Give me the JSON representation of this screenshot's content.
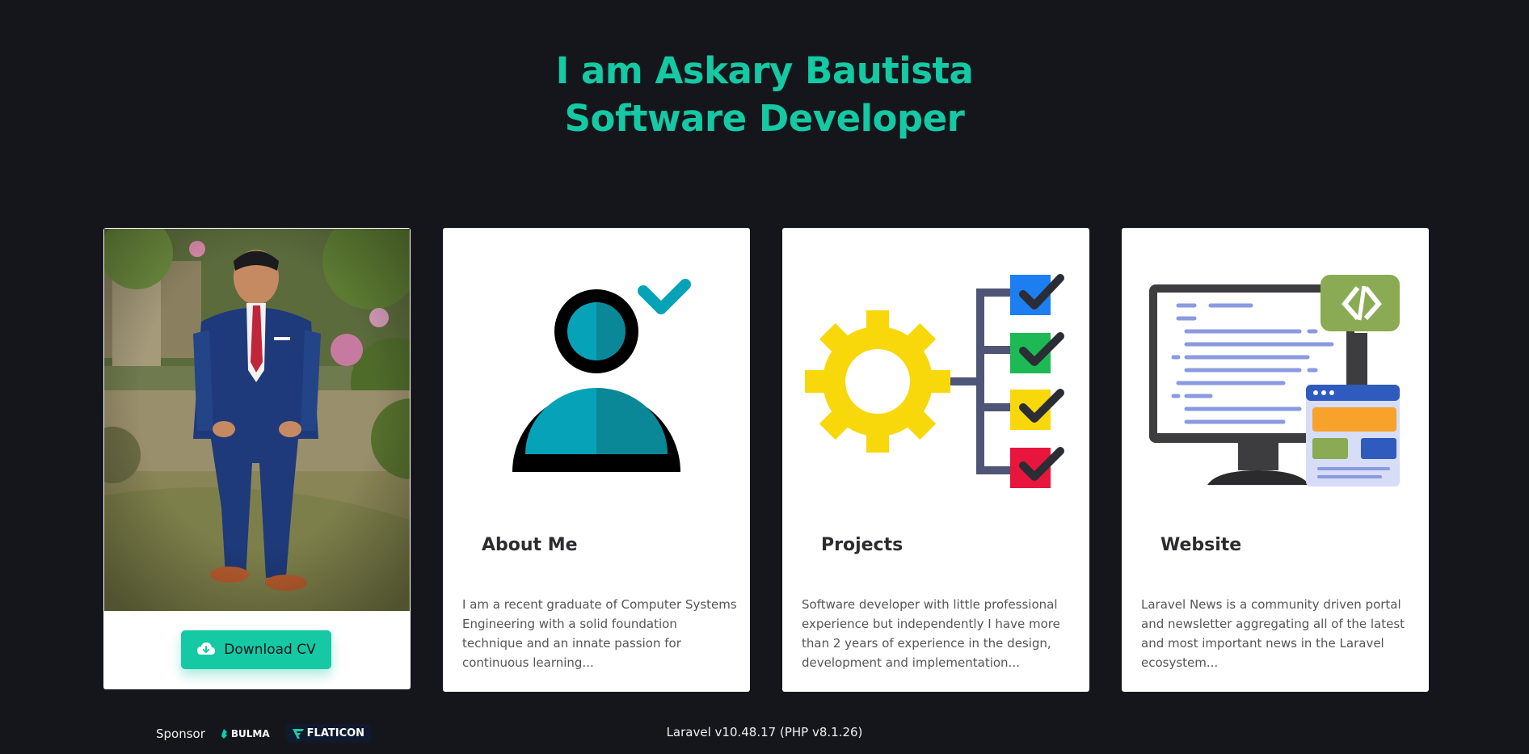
{
  "hero": {
    "line1": "I am Askary Bautista",
    "line2": "Software Developer",
    "color": "#14c9a4"
  },
  "profile": {
    "photo_alt": "Portrait photo",
    "download_label": "Download CV",
    "download_icon": "cloud-download-icon"
  },
  "cards": [
    {
      "title": "About Me",
      "icon": "user-check-illustration",
      "text": "I am a recent graduate of Computer Systems Engineering with a solid foundation technique and an innate passion for continuous learning..."
    },
    {
      "title": "Projects",
      "icon": "gear-checklist-illustration",
      "text": "Software developer with little professional experience but independently I have more than 2 years of experience in the design, development and implementation..."
    },
    {
      "title": "Website",
      "icon": "monitor-code-illustration",
      "text": "Laravel News is a community driven portal and newsletter aggregating all of the latest and most important news in the Laravel ecosystem..."
    }
  ],
  "footer": {
    "sponsor_label": "Sponsor",
    "bulma_label": "BULMA",
    "flaticon_label": "FLATICON",
    "version": "Laravel v10.48.17 (PHP v8.1.26)"
  }
}
